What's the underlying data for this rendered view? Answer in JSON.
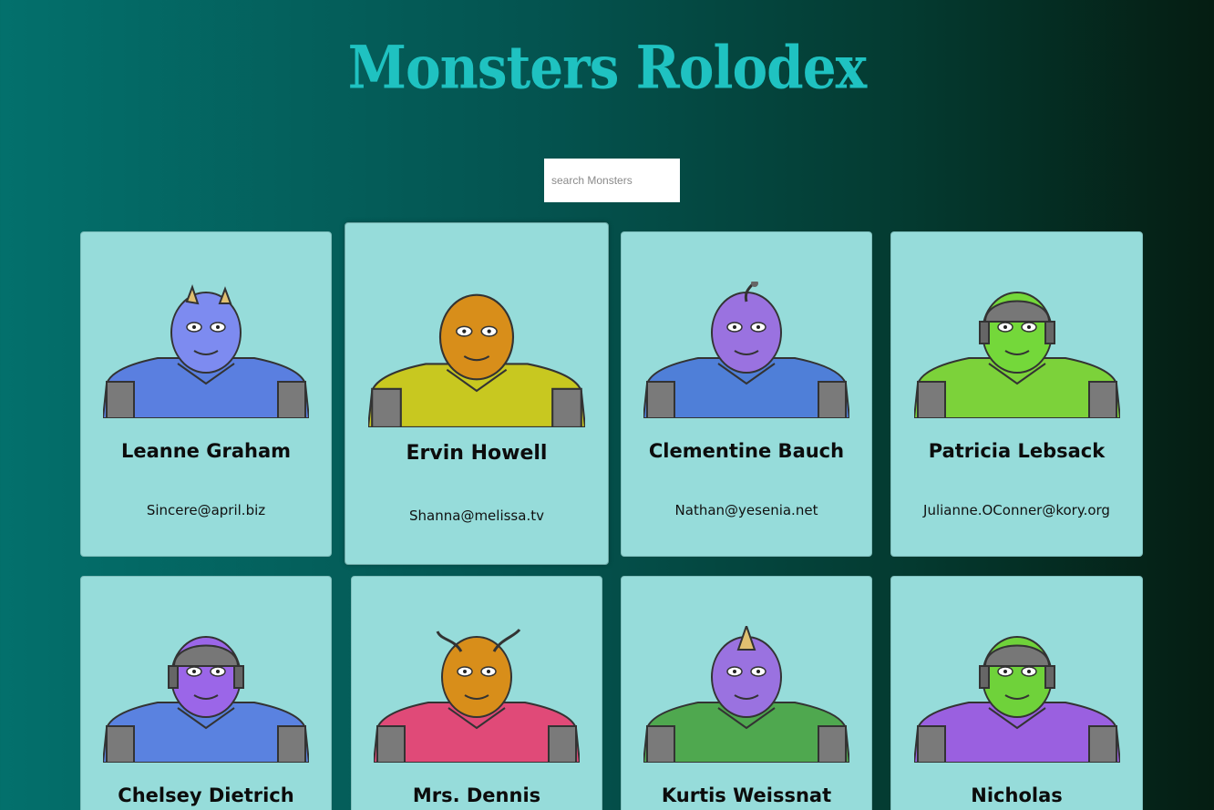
{
  "app": {
    "title": "Monsters Rolodex"
  },
  "search": {
    "placeholder": "search Monsters",
    "value": ""
  },
  "monsters": [
    {
      "name": "Leanne Graham",
      "email": "Sincere@april.biz",
      "body": "#5a7fe0",
      "head": "#7d8bf0",
      "feature": "horns-tan"
    },
    {
      "name": "Ervin Howell",
      "email": "Shanna@melissa.tv",
      "body": "#c8c820",
      "head": "#d88e1a",
      "feature": "none"
    },
    {
      "name": "Clementine Bauch",
      "email": "Nathan@yesenia.net",
      "body": "#4f7fd8",
      "head": "#9a72e0",
      "feature": "antenna"
    },
    {
      "name": "Patricia Lebsack",
      "email": "Julianne.OConner@kory.org",
      "body": "#7cd23a",
      "head": "#74d83a",
      "feature": "helmet"
    },
    {
      "name": "Chelsey Dietrich",
      "email": "",
      "body": "#5a82e0",
      "head": "#9b66e8",
      "feature": "helmet"
    },
    {
      "name": "Mrs. Dennis",
      "email": "",
      "body": "#e04a78",
      "head": "#d88e1a",
      "feature": "antennae"
    },
    {
      "name": "Kurtis Weissnat",
      "email": "",
      "body": "#4fa84f",
      "head": "#9a72e0",
      "feature": "horn"
    },
    {
      "name": "Nicholas",
      "email": "",
      "body": "#9a60e0",
      "head": "#6fd23a",
      "feature": "helmet"
    }
  ],
  "colors": {
    "card_bg": "#96dcda",
    "title": "#1fc2c1"
  }
}
